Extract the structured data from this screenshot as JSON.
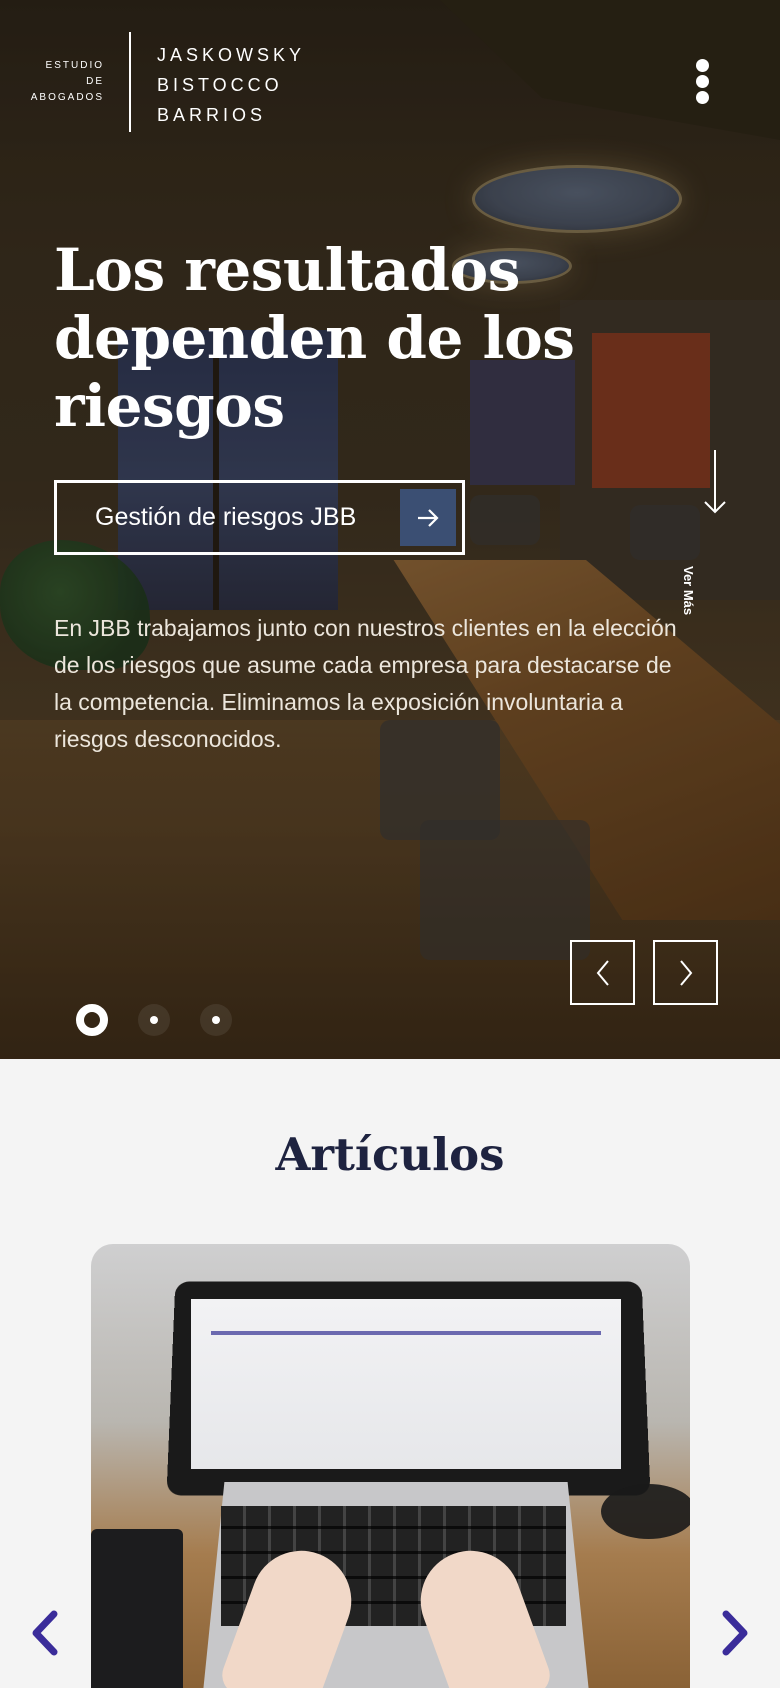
{
  "header": {
    "logo_small_lines": [
      "ESTUDIO",
      "DE",
      "ABOGADOS"
    ],
    "logo_big_lines": [
      "JASKOWSKY",
      "BISTOCCO",
      "BARRIOS"
    ]
  },
  "hero": {
    "title": "Los resultados dependen de los riesgos",
    "cta_label": "Gestión de riesgos JBB",
    "description": "En JBB trabajamos junto con nuestros clientes en la elección de los riesgos que asume cada empresa para destacarse de la competencia. Eliminamos la exposición involuntaria a riesgos desconocidos.",
    "scroll_label": "Ver Más",
    "slides_total": 3,
    "active_slide": 1
  },
  "articles": {
    "heading": "Artículos"
  },
  "colors": {
    "accent_navy": "#1e2340",
    "cta_arrow_bg": "#3b4f73",
    "article_arrow": "#3a2c9a",
    "section_bg": "#f4f4f4"
  },
  "icons": {
    "menu": "kebab-menu-icon",
    "cta": "arrow-right-icon",
    "scroll": "arrow-down-icon",
    "prev": "chevron-left-icon",
    "next": "chevron-right-icon"
  }
}
